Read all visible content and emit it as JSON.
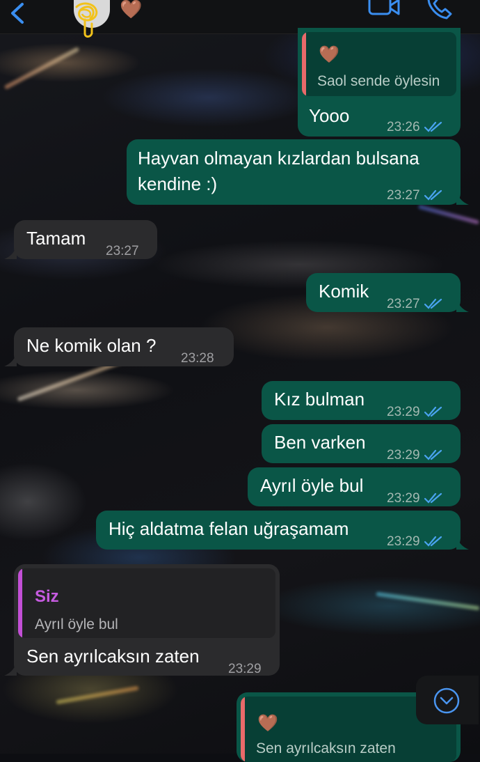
{
  "header": {
    "back_icon": "chevron-left-icon",
    "contact_emoji": "🤎",
    "video_icon": "video-camera-icon",
    "phone_icon": "phone-icon",
    "accent_color": "#3a8ef0"
  },
  "messages": [
    {
      "id": "m1",
      "direction": "outgoing",
      "quote": {
        "emoji": "🤎",
        "text": "Saol sende öylesin"
      },
      "text": "Yooo",
      "time": "23:26",
      "status": "read"
    },
    {
      "id": "m2",
      "direction": "outgoing",
      "text_line1": "Hayvan olmayan kızlardan bulsana",
      "text_line2": "kendine :)",
      "time": "23:27",
      "status": "read"
    },
    {
      "id": "m3",
      "direction": "incoming",
      "text": "Tamam",
      "time": "23:27"
    },
    {
      "id": "m4",
      "direction": "outgoing",
      "text": "Komik",
      "time": "23:27",
      "status": "read"
    },
    {
      "id": "m5",
      "direction": "incoming",
      "text": "Ne komik olan ?",
      "time": "23:28"
    },
    {
      "id": "m6",
      "direction": "outgoing",
      "text": "Kız bulman",
      "time": "23:29",
      "status": "read"
    },
    {
      "id": "m7",
      "direction": "outgoing",
      "text": "Ben varken",
      "time": "23:29",
      "status": "read"
    },
    {
      "id": "m8",
      "direction": "outgoing",
      "text": "Ayrıl öyle bul",
      "time": "23:29",
      "status": "read"
    },
    {
      "id": "m9",
      "direction": "outgoing",
      "text": "Hiç aldatma felan uğraşamam",
      "time": "23:29",
      "status": "read"
    },
    {
      "id": "m10",
      "direction": "incoming",
      "quote": {
        "author": "Siz",
        "text": "Ayrıl öyle bul"
      },
      "text": "Sen ayrılcaksın zaten",
      "time": "23:29"
    },
    {
      "id": "m11",
      "direction": "outgoing",
      "quote": {
        "emoji": "🤎",
        "text": "Sen ayrılcaksın zaten"
      }
    }
  ],
  "scroll_down_icon": "chevron-down-circle-icon",
  "colors": {
    "outgoing_bubble": "#0a5647",
    "incoming_bubble": "#2b2b2d",
    "quote_bar_outgoing": "#e86a6a",
    "quote_bar_incoming": "#c34fd6",
    "quote_author": "#c65be0",
    "read_ticks": "#4aa3f0"
  }
}
